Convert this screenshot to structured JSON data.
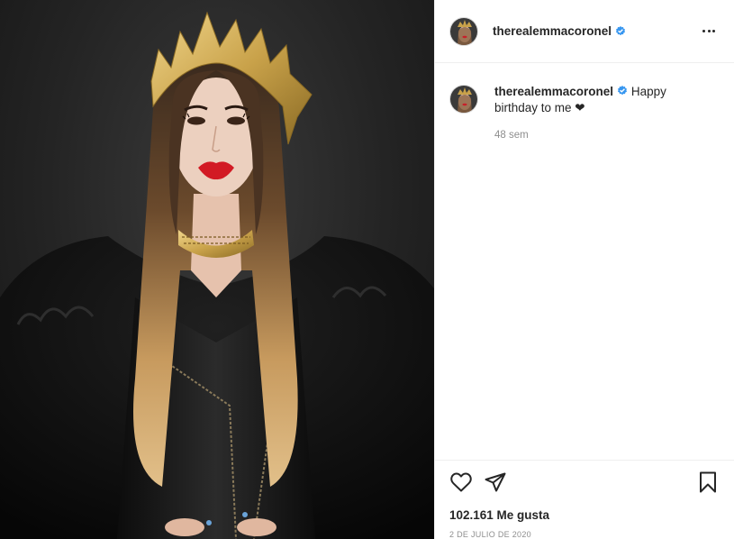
{
  "post": {
    "username": "therealemmacoronel",
    "verified": true,
    "caption": "Happy birthday to me ❤",
    "time_ago": "48 sem",
    "likes": "102.161 Me gusta",
    "date": "2 DE JULIO DE 2020"
  },
  "icons": {
    "more": "more-options-icon",
    "like": "heart-icon",
    "share": "paper-plane-icon",
    "save": "bookmark-icon",
    "verified": "verified-badge-icon"
  },
  "colors": {
    "verified_blue": "#3897f0",
    "muted_text": "#8e8e8e",
    "border": "#efefef"
  }
}
